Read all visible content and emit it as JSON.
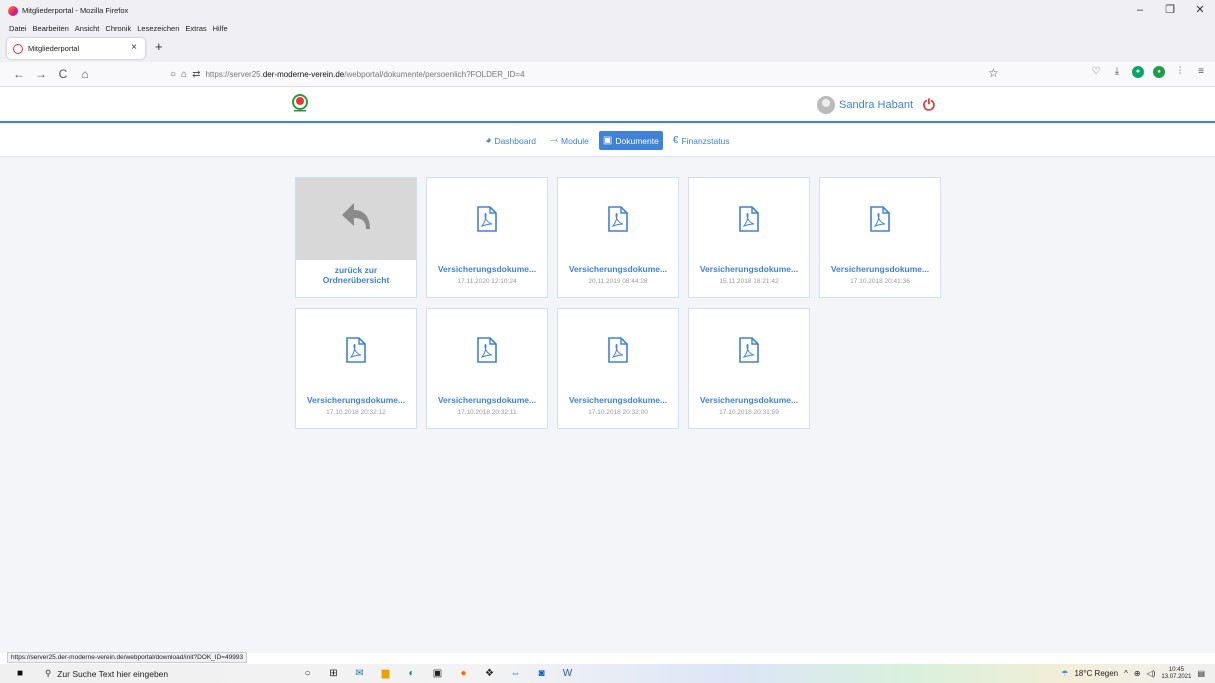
{
  "window": {
    "title": "Mitgliederportal - Mozilla Firefox",
    "controls": [
      "–",
      "❐",
      "✕"
    ]
  },
  "menu": [
    "Datei",
    "Bearbeiten",
    "Ansicht",
    "Chronik",
    "Lesezeichen",
    "Extras",
    "Hilfe"
  ],
  "tab": {
    "label": "Mitgliederportal",
    "close": "×",
    "new": "+"
  },
  "nav": {
    "back": "←",
    "forward": "→",
    "reload": "C",
    "home": "⌂"
  },
  "address": {
    "prefix": "https://server25.",
    "domain": "der-moderne-verein.de",
    "path": "/webportal/dokumente/persoenlich?FOLDER_ID=4"
  },
  "user": {
    "name": "Sandra Habant"
  },
  "subnav": [
    {
      "label": "Dashboard",
      "icon": "dashboard-icon",
      "glyph": "◕"
    },
    {
      "label": "Module",
      "icon": "module-icon",
      "glyph": "⤙"
    },
    {
      "label": "Dokumente",
      "icon": "documents-icon",
      "glyph": "▣"
    },
    {
      "label": "Finanzstatus",
      "icon": "euro-icon",
      "glyph": "€"
    }
  ],
  "back_card": {
    "label_line1": "zurück zur",
    "label_line2": "Ordnerübersicht"
  },
  "documents": [
    {
      "name": "Versicherungsdokume...",
      "date": "17.11.2020 12:10:24"
    },
    {
      "name": "Versicherungsdokume...",
      "date": "20.11.2019 08:44:28"
    },
    {
      "name": "Versicherungsdokume...",
      "date": "15.11.2018 18:21:42"
    },
    {
      "name": "Versicherungsdokume...",
      "date": "17.10.2018 20:41:36"
    },
    {
      "name": "Versicherungsdokume...",
      "date": "17.10.2018 20:32:12"
    },
    {
      "name": "Versicherungsdokume...",
      "date": "17.10.2018 20:32:11"
    },
    {
      "name": "Versicherungsdokume...",
      "date": "17.10.2018 20:32:00"
    },
    {
      "name": "Versicherungsdokume...",
      "date": "17.10.2018 20:31:59"
    }
  ],
  "status_url": "https://server25.der-moderne-verein.de/webportal/download/init?DOK_ID=49993",
  "taskbar": {
    "search_placeholder": "Zur Suche Text hier eingeben",
    "weather": "18°C Regen",
    "time": "10:45",
    "date": "13.07.2021"
  },
  "colors": {
    "accent": "#3f82d6",
    "power": "#e53935",
    "page_bg": "#f3f5f8"
  }
}
